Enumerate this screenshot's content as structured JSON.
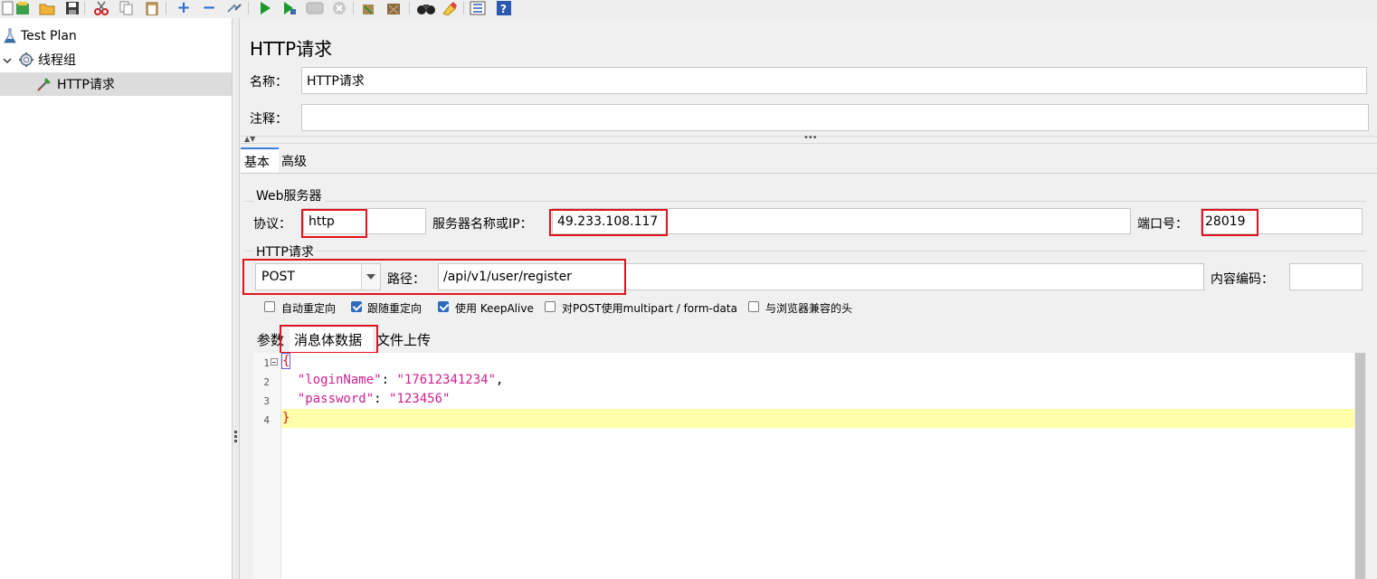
{
  "toolbar": {
    "icons": [
      "new-icon",
      "templates-icon",
      "open-icon",
      "save-icon",
      "cut-icon",
      "copy-icon",
      "paste-icon",
      "expand-icon",
      "collapse-icon",
      "toggle-icon",
      "start-icon",
      "start-no-pause-icon",
      "stop-icon",
      "shutdown-icon",
      "clear-icon",
      "clear-all-icon",
      "search-icon",
      "reset-search-icon",
      "function-helper-icon",
      "help-icon"
    ]
  },
  "tree": {
    "items": [
      {
        "label": "Test Plan",
        "icon": "test-plan-icon"
      },
      {
        "label": "线程组",
        "icon": "gear-icon"
      },
      {
        "label": "HTTP请求",
        "icon": "sampler-icon"
      }
    ]
  },
  "panel": {
    "title": "HTTP请求",
    "name_label": "名称：",
    "name_value": "HTTP请求",
    "comment_label": "注释：",
    "comment_value": "",
    "tabs": [
      "基本",
      "高级"
    ],
    "web_server": {
      "legend": "Web服务器",
      "protocol_label": "协议：",
      "protocol_value": "http",
      "server_label": "服务器名称或IP：",
      "server_value": "49.233.108.117",
      "port_label": "端口号：",
      "port_value": "28019"
    },
    "http_request": {
      "legend": "HTTP请求",
      "method": "POST",
      "path_label": "路径：",
      "path_value": "/api/v1/user/register",
      "encoding_label": "内容编码：",
      "encoding_value": ""
    },
    "options": [
      {
        "label": "自动重定向",
        "checked": false
      },
      {
        "label": "跟随重定向",
        "checked": true
      },
      {
        "label": "使用 KeepAlive",
        "checked": true
      },
      {
        "label": "对POST使用multipart / form-data",
        "checked": false
      },
      {
        "label": "与浏览器兼容的头",
        "checked": false
      }
    ],
    "subtabs": [
      "参数",
      "消息体数据",
      "文件上传"
    ],
    "body": {
      "line_numbers": [
        "1",
        "2",
        "3",
        "4"
      ],
      "open_brace": "{",
      "key1": "\"loginName\"",
      "val1": "\"17612341234\"",
      "key2": "\"password\"",
      "val2": "\"123456\"",
      "close_brace": "}"
    }
  },
  "colors": {
    "highlight_box": "#e0141e",
    "string_color": "#d0208f",
    "current_line": "#ffffaa",
    "checkbox_checked": "#2f6bbd"
  }
}
